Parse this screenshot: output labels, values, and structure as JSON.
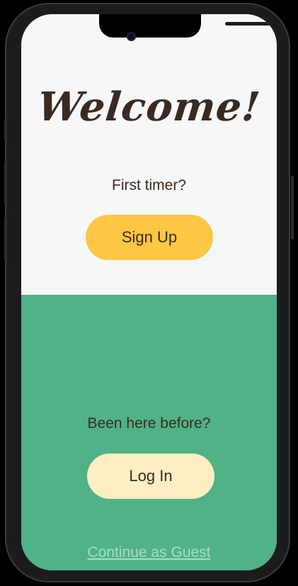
{
  "welcome": {
    "title": "Welcome!"
  },
  "signup": {
    "prompt": "First timer?",
    "button_label": "Sign Up"
  },
  "login": {
    "prompt": "Been here before?",
    "button_label": "Log In"
  },
  "guest": {
    "link_label": "Continue as Guest"
  },
  "colors": {
    "top_background": "#f6f7f9",
    "bottom_background": "#50b286",
    "signup_button": "#fdc645",
    "login_button": "#fdeec3",
    "text_dark": "#3b2a20",
    "guest_link": "#a9dcc5"
  }
}
